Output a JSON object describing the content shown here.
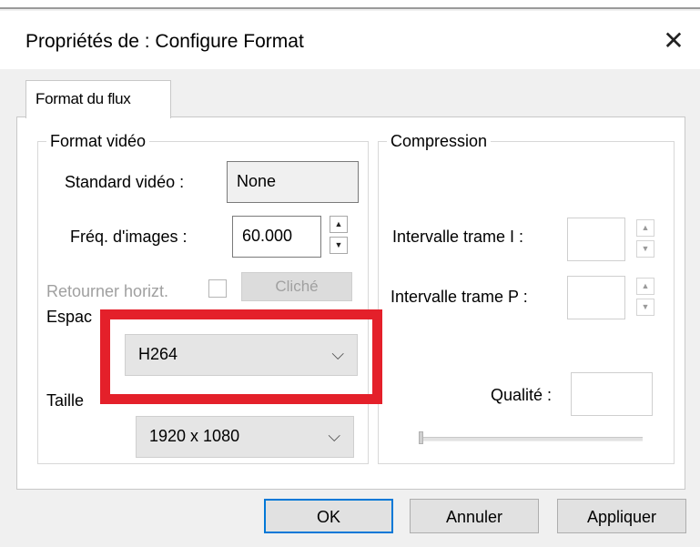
{
  "window": {
    "title": "Propriétés de : Configure Format",
    "close_glyph": "✕"
  },
  "tabs": [
    {
      "label": "Format du flux",
      "active": true
    }
  ],
  "video_format": {
    "legend": "Format vidéo",
    "standard_label": "Standard vidéo :",
    "standard_value": "None",
    "frame_rate_label": "Fréq. d'images :",
    "frame_rate_value": "60.000",
    "flip_label": "Retourner horizt.",
    "snapshot_label": "Cliché",
    "color_space_label": "Espac",
    "color_space_value": "H264",
    "size_label": "Taille",
    "size_value": "1920 x 1080"
  },
  "compression": {
    "legend": "Compression",
    "i_frame_label": "Intervalle trame I :",
    "p_frame_label": "Intervalle trame P :",
    "quality_label": "Qualité :"
  },
  "buttons": {
    "ok": "OK",
    "cancel": "Annuler",
    "apply": "Appliquer"
  },
  "icons": {
    "up": "▲",
    "down": "▼",
    "chevron": "⌵",
    "close": "close-icon"
  },
  "colors": {
    "highlight": "#e4202a",
    "default_button_border": "#0078d7"
  }
}
